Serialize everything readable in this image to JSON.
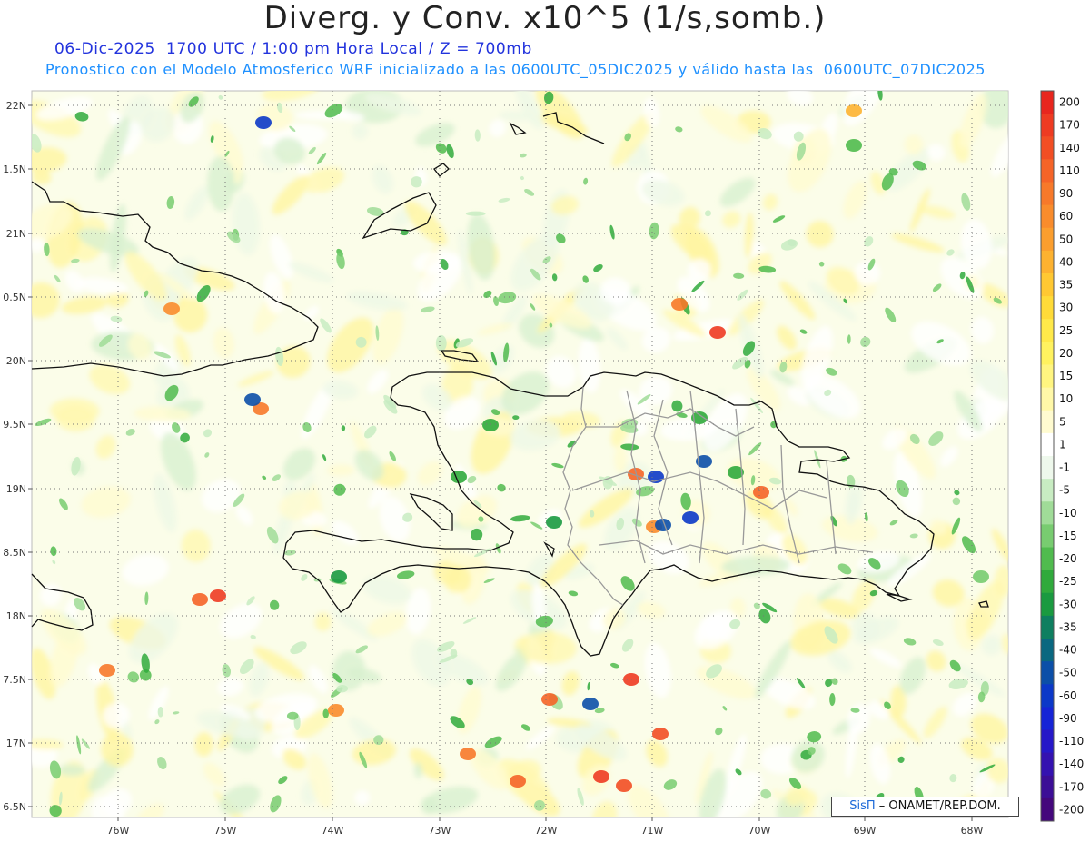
{
  "header": {
    "title": "Diverg. y Conv. x10^5 (1/s,somb.)",
    "line1": "06-Dic-2025  1700 UTC / 1:00 pm Hora Local / Z = 700mb",
    "line2": "Pronostico con el Modelo Atmosferico WRF inicializado a las 0600UTC_05DIC2025 y válido hasta las  0600UTC_07DIC2025"
  },
  "map": {
    "lon_ticks": [
      "76W",
      "75W",
      "74W",
      "73W",
      "72W",
      "71W",
      "70W",
      "69W",
      "68W"
    ],
    "lat_ticks": [
      "22N",
      "1.5N",
      "21N",
      "0.5N",
      "20N",
      "9.5N",
      "19N",
      "8.5N",
      "18N",
      "7.5N",
      "17N",
      "6.5N"
    ],
    "lon_range": [
      -76.6,
      -67.4
    ],
    "lat_range": [
      16.45,
      22.1
    ]
  },
  "colorbar": {
    "labels": [
      "200",
      "170",
      "140",
      "110",
      "90",
      "60",
      "50",
      "40",
      "35",
      "30",
      "25",
      "20",
      "15",
      "10",
      "5",
      "1",
      "-1",
      "-5",
      "-10",
      "-15",
      "-20",
      "-25",
      "-30",
      "-35",
      "-40",
      "-50",
      "-60",
      "-90",
      "-110",
      "-140",
      "-170",
      "-200"
    ],
    "colors": [
      "#e8261e",
      "#ee3b22",
      "#f24e24",
      "#f56428",
      "#f7792a",
      "#f98c2c",
      "#fb9e2e",
      "#fdb230",
      "#ffc832",
      "#ffdb38",
      "#ffe94a",
      "#fff25f",
      "#fff580",
      "#fff8a8",
      "#fffbd0",
      "#ffffff",
      "#eef8ec",
      "#c8ecc2",
      "#a0dc98",
      "#78cc70",
      "#50bb4e",
      "#30aa3c",
      "#1a9a40",
      "#0e7f60",
      "#0a6880",
      "#0c4fa8",
      "#0c38c8",
      "#1624d6",
      "#2618c8",
      "#3412b0",
      "#3c0e96",
      "#44087c"
    ]
  },
  "credit": {
    "sis": "SisΠ",
    "text": "– ONAMET/REP.DOM."
  }
}
